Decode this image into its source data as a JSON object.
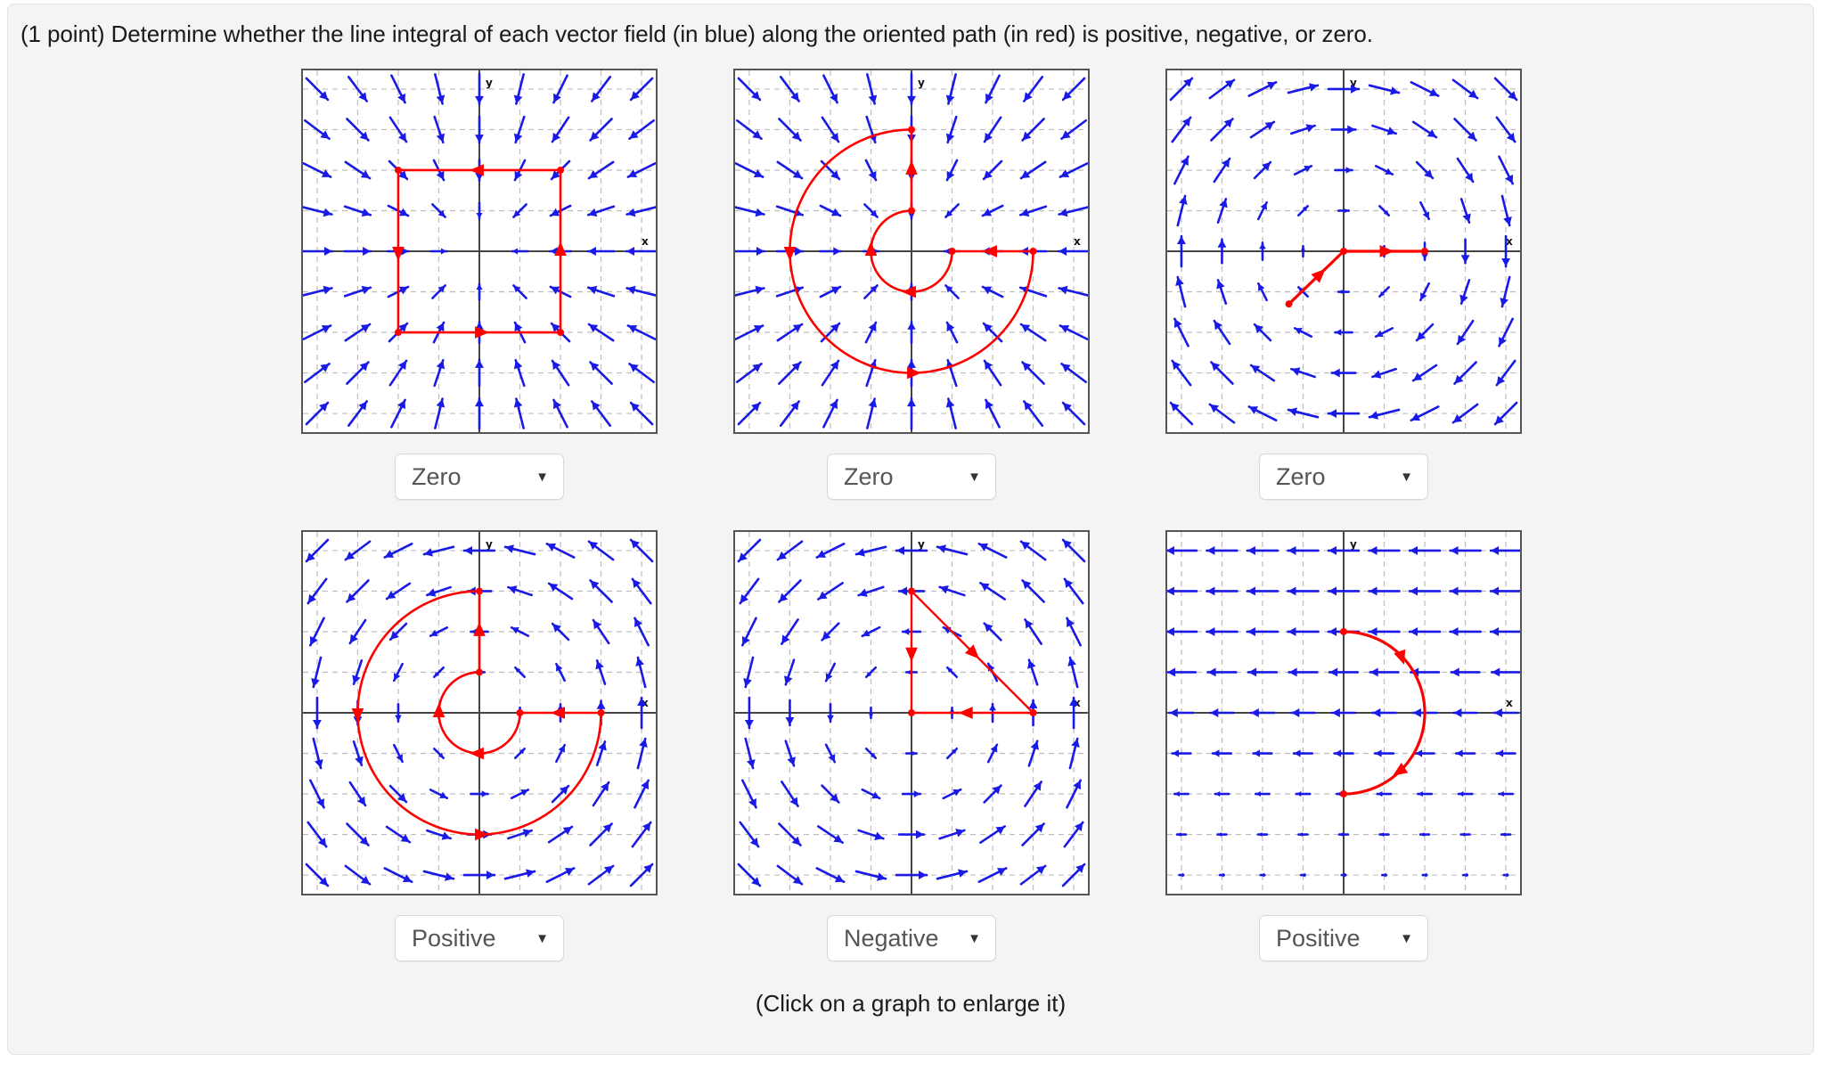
{
  "page": {
    "background": "#f4f4f4",
    "question": "(1 point) Determine whether the line integral of each vector field (in blue) along the oriented path (in red) is positive, negative, or zero.",
    "footer_note": "(Click on a graph to enlarge it)"
  },
  "colors": {
    "field": "#1a1ae6",
    "path": "#ff0000",
    "axis": "#444444",
    "grid": "#bdbdbd",
    "border": "#555555",
    "plot_bg": "#ffffff",
    "panel_bg": "#f4f4f4",
    "text": "#1a1a1a",
    "select_text": "#555555"
  },
  "axis_labels": {
    "x": "x",
    "y": "y"
  },
  "dropdown": {
    "caret_glyph": "▼",
    "options": [
      "Positive",
      "Negative",
      "Zero",
      "?"
    ]
  },
  "graphs": [
    {
      "id": "graph-1",
      "answer": "Zero",
      "field": {
        "type": "radial-inward",
        "description": "arrows point toward the origin"
      },
      "path": {
        "type": "rectangle",
        "description": "closed rectangle traversed clockwise",
        "vertices": [
          [
            -2,
            2
          ],
          [
            2,
            2
          ],
          [
            2,
            0
          ],
          [
            2,
            -2
          ],
          [
            -2,
            -2
          ],
          [
            -2,
            0
          ]
        ],
        "arrow_markers": [
          {
            "at": [
              0,
              2
            ],
            "dir": "left"
          },
          {
            "at": [
              2,
              0
            ],
            "dir": "up"
          },
          {
            "at": [
              0,
              -2
            ],
            "dir": "right"
          },
          {
            "at": [
              -2,
              0
            ],
            "dir": "down"
          }
        ]
      }
    },
    {
      "id": "graph-2",
      "answer": "Zero",
      "field": {
        "type": "radial-inward",
        "description": "arrows point toward the origin"
      },
      "path": {
        "type": "spiral-arcs",
        "description": "outer arc from (0,3) clockwise-to-left then around to (3,0), inner arc, plus radial segments",
        "arrow_markers": [
          {
            "at": [
              0,
              2
            ],
            "dir": "up"
          },
          {
            "at": [
              -3,
              0
            ],
            "dir": "down"
          },
          {
            "at": [
              0,
              -3
            ],
            "dir": "right"
          },
          {
            "at": [
              -1,
              0
            ],
            "dir": "up"
          },
          {
            "at": [
              0,
              -1
            ],
            "dir": "left"
          },
          {
            "at": [
              2,
              0
            ],
            "dir": "left"
          }
        ]
      }
    },
    {
      "id": "graph-3",
      "answer": "Zero",
      "field": {
        "type": "rotational-clockwise",
        "description": "arrows circulate clockwise about the origin"
      },
      "path": {
        "type": "polyline",
        "description": "segment from (-1,-1) up-right to origin then right along x-axis to (2,0)",
        "vertices": [
          [
            -1,
            -1
          ],
          [
            0,
            0
          ],
          [
            2,
            0
          ]
        ],
        "arrow_markers": [
          {
            "at": [
              -0.5,
              -0.5
            ],
            "dir": "up-right"
          },
          {
            "at": [
              1,
              0
            ],
            "dir": "right"
          }
        ]
      }
    },
    {
      "id": "graph-4",
      "answer": "Positive",
      "field": {
        "type": "rotational-counterclockwise",
        "description": "arrows circulate counterclockwise about the origin"
      },
      "path": {
        "type": "spiral-arcs",
        "description": "same spiral of arcs and radial segments as graph 2",
        "arrow_markers": [
          {
            "at": [
              0,
              2
            ],
            "dir": "up"
          },
          {
            "at": [
              -3,
              0
            ],
            "dir": "down"
          },
          {
            "at": [
              0,
              -3
            ],
            "dir": "right"
          },
          {
            "at": [
              -1,
              0
            ],
            "dir": "up"
          },
          {
            "at": [
              0,
              -1
            ],
            "dir": "left"
          },
          {
            "at": [
              2,
              0
            ],
            "dir": "left"
          }
        ]
      }
    },
    {
      "id": "graph-5",
      "answer": "Negative",
      "field": {
        "type": "rotational-counterclockwise-offset",
        "description": "arrows circulate counterclockwise, stronger away from center"
      },
      "path": {
        "type": "triangle",
        "description": "closed triangle (0,3) -> (3,0) -> (0,0) -> (0,3) traversed clockwise",
        "vertices": [
          [
            0,
            3
          ],
          [
            3,
            0
          ],
          [
            0,
            0
          ]
        ],
        "arrow_markers": [
          {
            "at": [
              1.5,
              1.5
            ],
            "dir": "down-right"
          },
          {
            "at": [
              1.5,
              0
            ],
            "dir": "right"
          },
          {
            "at": [
              0,
              1.5
            ],
            "dir": "down"
          }
        ]
      }
    },
    {
      "id": "graph-6",
      "answer": "Positive",
      "field": {
        "type": "uniform-left",
        "description": "all arrows point in the negative x direction, magnitude varies with height"
      },
      "path": {
        "type": "semicircle",
        "description": "semicircular arc from (0,2) rightward through (2,0) down to (0,-2)",
        "endpoints": [
          [
            0,
            2
          ],
          [
            0,
            -2
          ]
        ],
        "arrow_markers": [
          {
            "at": [
              1.4,
              1.4
            ],
            "dir": "down-right"
          },
          {
            "at": [
              1.4,
              -1.4
            ],
            "dir": "down-left"
          }
        ]
      }
    }
  ]
}
